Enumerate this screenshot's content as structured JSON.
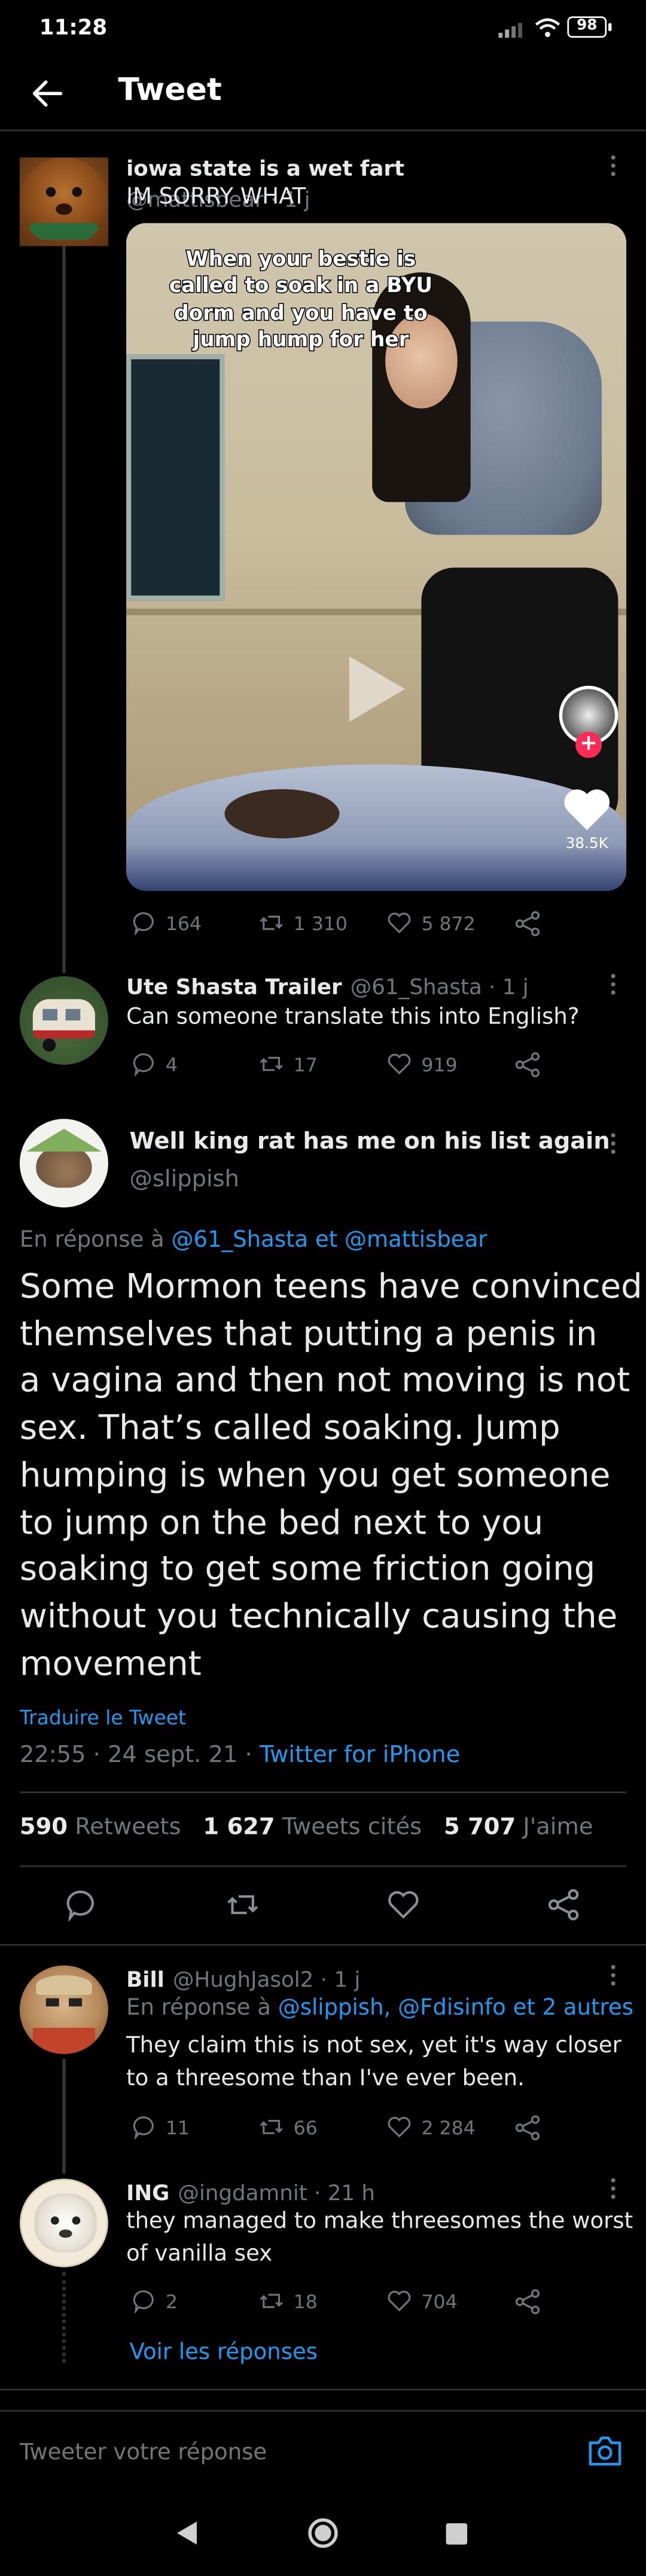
{
  "status_bar": {
    "time": "11:28",
    "battery": "98"
  },
  "header": {
    "title": "Tweet"
  },
  "tweets": [
    {
      "name": "iowa state is a wet fart",
      "handle": "@mattisbear · 1 j",
      "text": "IM SORRY WHAT",
      "media": {
        "caption_lines": [
          "When your bestie is",
          "called to soak in a BYU",
          "dorm and you have to",
          "jump hump for her"
        ],
        "likes_overlay": "38.5K"
      },
      "replies": "164",
      "retweets": "1 310",
      "likes": "5 872"
    },
    {
      "name": "Ute Shasta Trailer",
      "handle": "@61_Shasta · 1 j",
      "text": "Can someone translate this into English?",
      "replies": "4",
      "retweets": "17",
      "likes": "919"
    }
  ],
  "main_tweet": {
    "name": "Well king rat has me on his list again",
    "handle": "@slippish",
    "reply_to_prefix": "En réponse à",
    "reply_to": "@61_Shasta et @mattisbear",
    "text_lines": [
      "Some Mormon teens have convinced",
      "themselves that putting a penis in",
      "a vagina and then not moving is not",
      "sex. That’s called soaking. Jump",
      "humping is when you get someone",
      "to jump on the bed next to you",
      "soaking to get some friction going",
      "without you technically causing the",
      "movement"
    ],
    "translate": "Traduire le Tweet",
    "timestamp": "22:55 · 24 sept. 21 · ",
    "source": "Twitter for iPhone",
    "retweets_count": "590",
    "retweets_label": "Retweets",
    "quotes_count": "1 627",
    "quotes_label": "Tweets cités",
    "likes_count": "5 707",
    "likes_label": "J'aime"
  },
  "replies": [
    {
      "name": "Bill",
      "handle": "@HughJasol2 · 1 j",
      "reply_to_prefix": "En réponse à",
      "reply_to": "@slippish, @Fdisinfo et 2 autres",
      "text_lines": [
        "They claim this is not sex, yet it's way closer",
        "to a threesome than I've ever been."
      ],
      "replies": "11",
      "retweets": "66",
      "likes": "2 284"
    },
    {
      "name": "ING",
      "handle": "@ingdamnit · 21 h",
      "text_lines": [
        "they managed to make threesomes the worst",
        "of vanilla sex"
      ],
      "replies": "2",
      "retweets": "18",
      "likes": "704"
    }
  ],
  "show_replies": "Voir les réponses",
  "composer": {
    "placeholder": "Tweeter votre réponse"
  },
  "colors": {
    "accent": "#1d9bf0",
    "background": "#000000",
    "muted": "#71767b",
    "text": "#e7e9ea"
  }
}
